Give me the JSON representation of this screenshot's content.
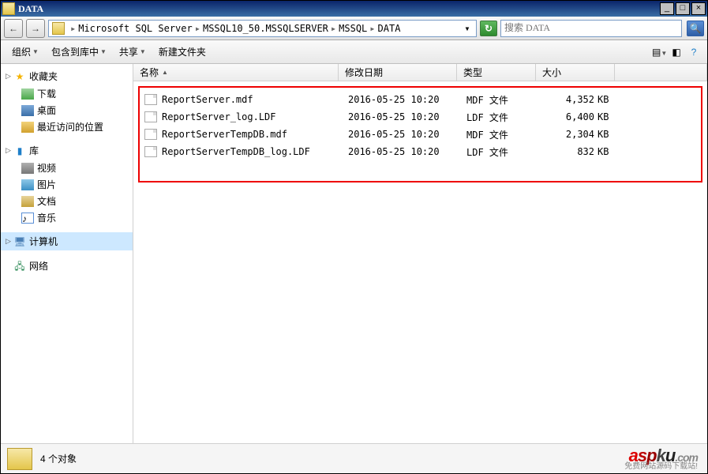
{
  "window": {
    "title": "DATA"
  },
  "nav": {
    "back": "←",
    "fwd": "→"
  },
  "breadcrumbs": {
    "b1": "Microsoft SQL Server",
    "b2": "MSSQL10_50.MSSQLSERVER",
    "b3": "MSSQL",
    "b4": "DATA"
  },
  "search": {
    "placeholder": "搜索 DATA"
  },
  "toolbar": {
    "organize": "组织",
    "include": "包含到库中",
    "share": "共享",
    "newfolder": "新建文件夹"
  },
  "sidebar": {
    "favorites": {
      "label": "收藏夹",
      "downloads": "下载",
      "desktop": "桌面",
      "recent": "最近访问的位置"
    },
    "libraries": {
      "label": "库",
      "videos": "视频",
      "pictures": "图片",
      "documents": "文档",
      "music": "音乐"
    },
    "computer": {
      "label": "计算机"
    },
    "network": {
      "label": "网络"
    }
  },
  "columns": {
    "name": "名称",
    "date": "修改日期",
    "type": "类型",
    "size": "大小"
  },
  "files": [
    {
      "name": "ReportServer.mdf",
      "date": "2016-05-25 10:20",
      "type": "MDF 文件",
      "size": "4,352",
      "unit": "KB"
    },
    {
      "name": "ReportServer_log.LDF",
      "date": "2016-05-25 10:20",
      "type": "LDF 文件",
      "size": "6,400",
      "unit": "KB"
    },
    {
      "name": "ReportServerTempDB.mdf",
      "date": "2016-05-25 10:20",
      "type": "MDF 文件",
      "size": "2,304",
      "unit": "KB"
    },
    {
      "name": "ReportServerTempDB_log.LDF",
      "date": "2016-05-25 10:20",
      "type": "LDF 文件",
      "size": "832",
      "unit": "KB"
    }
  ],
  "status": {
    "count_text": "4 个对象"
  },
  "watermark": {
    "brand_a": "a",
    "brand_s": "s",
    "brand_p": "p",
    "brand_k": "k",
    "brand_u": "u",
    "brand_com": ".com",
    "sub": "免费网站源码下载站!"
  }
}
